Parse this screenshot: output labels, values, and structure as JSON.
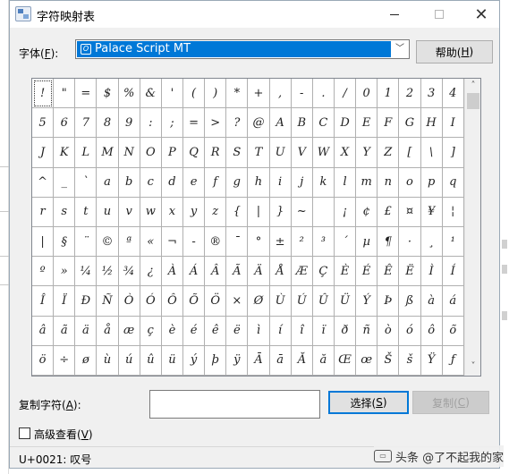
{
  "window": {
    "title": "字符映射表",
    "min_glyph": "",
    "close_glyph": "✕"
  },
  "font_row": {
    "label": "字体(",
    "label_key": "F",
    "label_end": "):",
    "selected_font": "Palace Script MT",
    "help_label": "帮助(",
    "help_key": "H",
    "help_end": ")"
  },
  "grid": {
    "columns": 20,
    "rows": 10,
    "selected_index": 0,
    "glyphs": [
      "!",
      "\"",
      "=",
      "$",
      "%",
      "&",
      "'",
      "(",
      ")",
      "*",
      "+",
      ",",
      "-",
      ".",
      "/",
      "0",
      "1",
      "2",
      "3",
      "4",
      "5",
      "6",
      "7",
      "8",
      "9",
      ":",
      ";",
      "=",
      ">",
      "?",
      "@",
      "A",
      "B",
      "C",
      "D",
      "E",
      "F",
      "G",
      "H",
      "I",
      "J",
      "K",
      "L",
      "M",
      "N",
      "O",
      "P",
      "Q",
      "R",
      "S",
      "T",
      "U",
      "V",
      "W",
      "X",
      "Y",
      "Z",
      "[",
      "\\",
      "]",
      "^",
      "_",
      "`",
      "a",
      "b",
      "c",
      "d",
      "e",
      "f",
      "g",
      "h",
      "i",
      "j",
      "k",
      "l",
      "m",
      "n",
      "o",
      "p",
      "q",
      "r",
      "s",
      "t",
      "u",
      "v",
      "w",
      "x",
      "y",
      "z",
      "{",
      "|",
      "}",
      "~",
      " ",
      "¡",
      "¢",
      "£",
      "¤",
      "¥",
      "¦",
      "|",
      "§",
      "¨",
      "©",
      "ª",
      "«",
      "¬",
      "-",
      "®",
      "¯",
      "°",
      "±",
      "²",
      "³",
      "´",
      "µ",
      "¶",
      "·",
      "¸",
      "¹",
      "º",
      "»",
      "¼",
      "½",
      "¾",
      "¿",
      "À",
      "Á",
      "Â",
      "Ã",
      "Ä",
      "Å",
      "Æ",
      "Ç",
      "È",
      "É",
      "Ê",
      "Ë",
      "Ì",
      "Í",
      "Î",
      "Ï",
      "Ð",
      "Ñ",
      "Ò",
      "Ó",
      "Ô",
      "Õ",
      "Ö",
      "×",
      "Ø",
      "Ù",
      "Ú",
      "Û",
      "Ü",
      "Ý",
      "Þ",
      "ß",
      "à",
      "á",
      "â",
      "ã",
      "ä",
      "å",
      "æ",
      "ç",
      "è",
      "é",
      "ê",
      "ë",
      "ì",
      "í",
      "î",
      "ï",
      "ð",
      "ñ",
      "ò",
      "ó",
      "ô",
      "õ",
      "ö",
      "÷",
      "ø",
      "ù",
      "ú",
      "û",
      "ü",
      "ý",
      "þ",
      "ÿ",
      "Ā",
      "ā",
      "Ă",
      "ă",
      "Œ",
      "œ",
      "Š",
      "š",
      "Ÿ",
      "ƒ"
    ],
    "scroll_up": "˄",
    "scroll_down": "˅"
  },
  "copy_row": {
    "label": "复制字符(",
    "label_key": "A",
    "label_end": "):",
    "value": "",
    "select_label": "选择(",
    "select_key": "S",
    "select_end": ")",
    "copy_label": "复制(",
    "copy_key": "C",
    "copy_end": ")"
  },
  "advanced": {
    "label": "高级查看(",
    "label_key": "V",
    "label_end": ")",
    "checked": false
  },
  "status": {
    "text": "U+0021: 叹号"
  },
  "watermark": {
    "text": "头条 @了不起我的家"
  }
}
